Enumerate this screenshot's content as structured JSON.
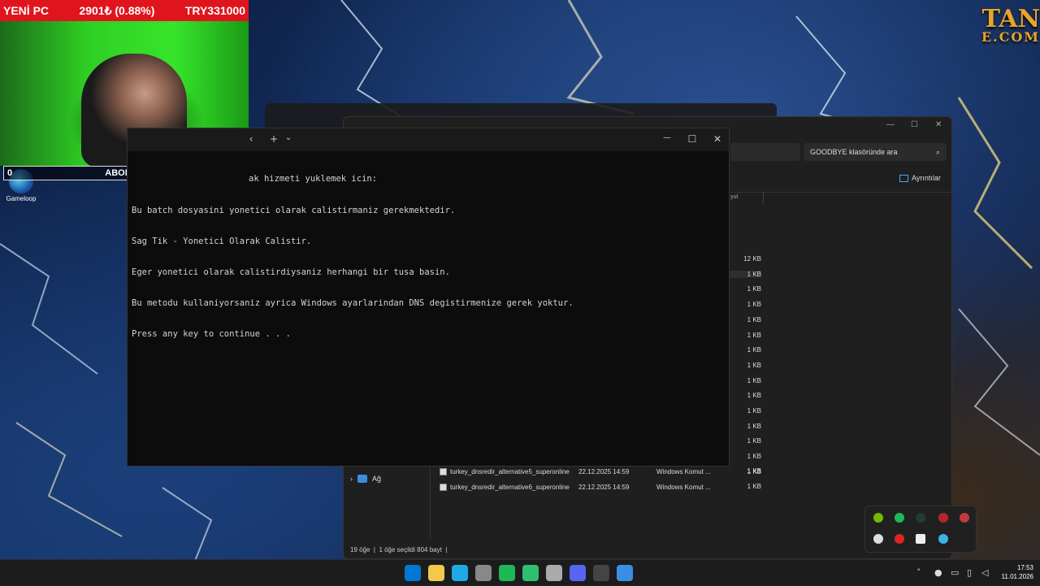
{
  "overlay": {
    "goal_title": "YENİ PC",
    "goal_progress": "2901₺ (0.88%)",
    "goal_target": "TRY331000",
    "sub_count": "0",
    "sub_label": "ABONE",
    "brand_line1": "TAN",
    "brand_line2": "E.COM"
  },
  "desktop": {
    "gameloop_label": "Gameloop"
  },
  "terminal": {
    "lines": [
      "ak hizmeti yuklemek icin:",
      "Bu batch dosyasini yonetici olarak calistirmaniz gerekmektedir.",
      "Sag Tik - Yonetici Olarak Calistir.",
      "Eger yonetici olarak calistirdiysaniz herhangi bir tusa basin.",
      "Bu metodu kullaniyorsaniz ayrica Windows ayarlarindan DNS degistirmenize gerek yoktur.",
      "Press any key to continue . . ."
    ],
    "new_tab_symbol": "+",
    "dropdown_symbol": "⌄",
    "back_symbol": "‹",
    "minimize_symbol": "—",
    "maximize_symbol": "☐",
    "close_symbol": "✕"
  },
  "explorer": {
    "search_placeholder": "GOODBYE klasöründe ara",
    "details_label": "Ayrıntılar",
    "size_column_header": "yut",
    "sizes": [
      "12 KB",
      "1 KB",
      "1 KB",
      "1 KB",
      "1 KB",
      "1 KB",
      "1 KB",
      "1 KB",
      "1 KB",
      "1 KB",
      "1 KB",
      "1 KB",
      "1 KB",
      "1 KB",
      "1 KB"
    ],
    "files": [
      {
        "name": "turkey_dnsredir_alternative5_superonline",
        "date": "22.12.2025 14:59",
        "type": "Windows Komut ...",
        "size": "1 KB"
      },
      {
        "name": "turkey_dnsredir_alternative6_superonline",
        "date": "22.12.2025 14:59",
        "type": "Windows Komut ...",
        "size": "1 KB"
      }
    ],
    "nav_network_label": "Ağ",
    "status_items": "19 öğe",
    "status_selected": "1 öğe seçildi  804 bayt"
  },
  "taskbar": {
    "time": "17:53",
    "date": "11.01.2026",
    "app_colors": [
      "#0078d4",
      "#f2c94c",
      "#1fa9e8",
      "#888888",
      "#1db954",
      "#2fbf71",
      "#aaaaaa",
      "#5865f2",
      "#444444",
      "#3a8ee6"
    ]
  }
}
